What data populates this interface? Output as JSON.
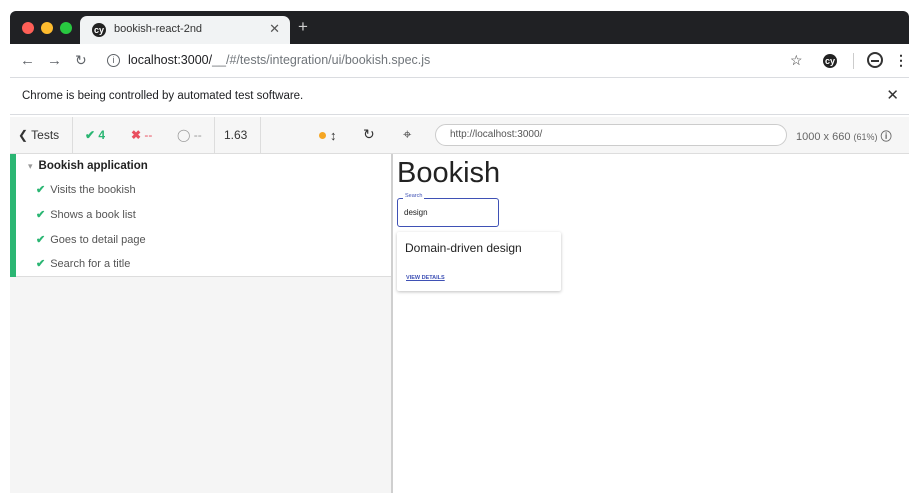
{
  "browser": {
    "tab_title": "bookish-react-2nd",
    "tab_icon": "cypress-logo-icon",
    "new_tab_label": "+",
    "url_host": "localhost:3000/",
    "url_path": "__/#/tests/integration/ui/bookish.spec.js",
    "infobar_text": "Chrome is being controlled by automated test software."
  },
  "reporter": {
    "tests_label": "Tests",
    "passed": "4",
    "failed": "--",
    "pending": "--",
    "duration": "1.63",
    "suite": "Bookish application",
    "tests": [
      "Visits the bookish",
      "Shows a book list",
      "Goes to detail page",
      "Search for a title"
    ]
  },
  "aut": {
    "url": "http://localhost:3000/",
    "viewport": "1000 x 660",
    "scale": "(61%)"
  },
  "app": {
    "title": "Bookish",
    "search_label": "Search",
    "search_value": "design",
    "card_title": "Domain-driven design",
    "card_link": "VIEW DETAILS"
  },
  "colors": {
    "pass": "#2bb673",
    "fail": "#e94f5f",
    "accent": "#3f51b5"
  }
}
